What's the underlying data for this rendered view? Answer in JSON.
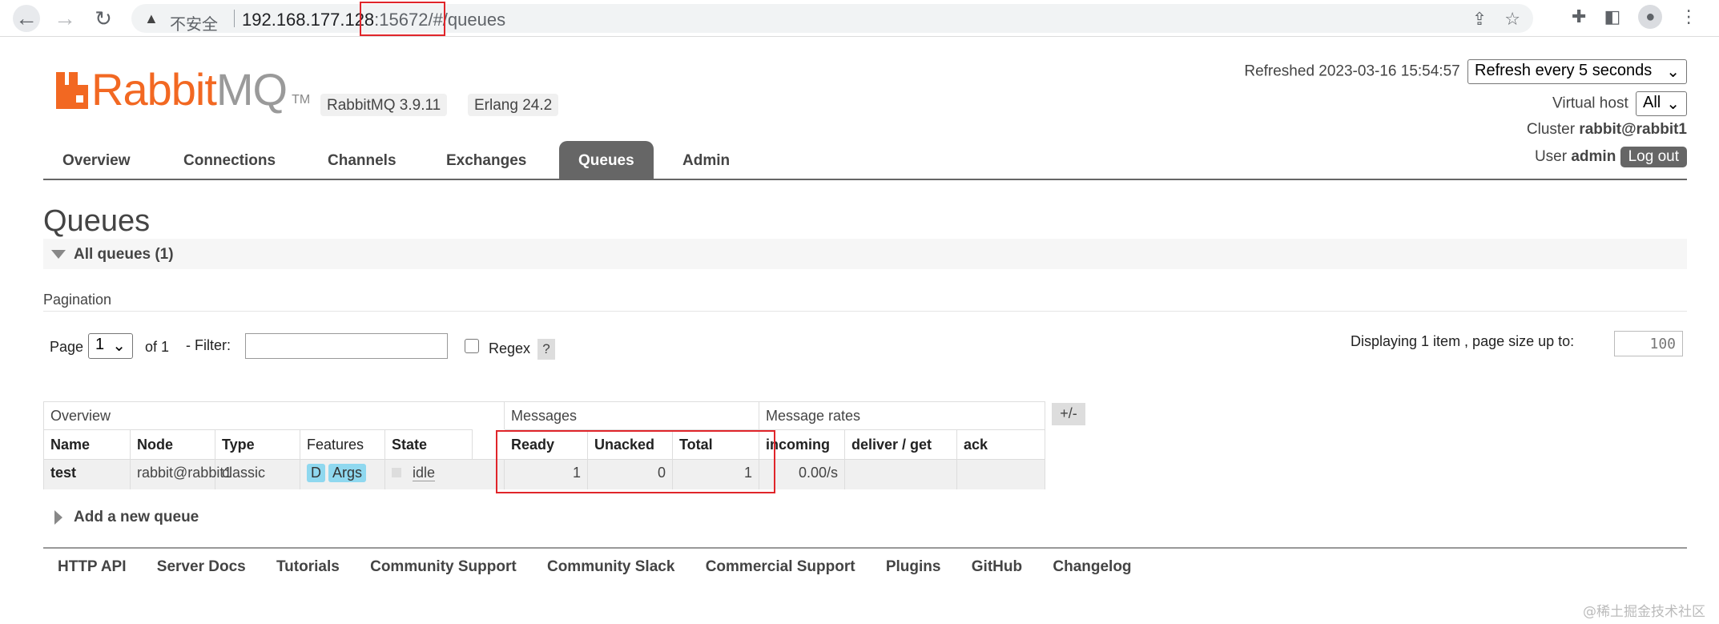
{
  "browser": {
    "insecure_label": "不安全",
    "url_host": "192.168.177.128",
    "url_rest": ":15672/#/queues"
  },
  "brand": {
    "logo_rabbit": "Rabbit",
    "logo_mq": "MQ",
    "logo_tm": "TM",
    "version": "RabbitMQ 3.9.11",
    "erlang": "Erlang 24.2",
    "accent_color": "#f26822"
  },
  "status": {
    "refreshed": "Refreshed 2023-03-16 15:54:57",
    "refresh_option": "Refresh every 5 seconds",
    "vhost_label": "Virtual host",
    "vhost_value": "All",
    "cluster_label": "Cluster",
    "cluster_value": "rabbit@rabbit1",
    "user_label": "User",
    "user_value": "admin",
    "logout": "Log out"
  },
  "tabs": [
    "Overview",
    "Connections",
    "Channels",
    "Exchanges",
    "Queues",
    "Admin"
  ],
  "page": {
    "title": "Queues",
    "section": "All queues (1)",
    "pagination_label": "Pagination",
    "page_label": "Page",
    "page_value": "1",
    "of_label": "of 1",
    "filter_label": "- Filter:",
    "regex_label": "Regex",
    "help": "?",
    "displaying": "Displaying 1 item , page size up to:",
    "page_size": "100"
  },
  "table": {
    "groups": [
      "Overview",
      "Messages",
      "Message rates"
    ],
    "plus_minus": "+/-",
    "headers": [
      "Name",
      "Node",
      "Type",
      "Features",
      "State",
      "Ready",
      "Unacked",
      "Total",
      "incoming",
      "deliver / get",
      "ack"
    ],
    "rows": [
      {
        "name": "test",
        "node": "rabbit@rabbit1",
        "type": "classic",
        "feature_d": "D",
        "feature_args": "Args",
        "state": "idle",
        "ready": "1",
        "unacked": "0",
        "total": "1",
        "incoming": "0.00/s",
        "deliver_get": "",
        "ack": ""
      }
    ]
  },
  "add_queue": "Add a new queue",
  "footer": [
    "HTTP API",
    "Server Docs",
    "Tutorials",
    "Community Support",
    "Community Slack",
    "Commercial Support",
    "Plugins",
    "GitHub",
    "Changelog"
  ],
  "watermark": "@稀土掘金技术社区"
}
